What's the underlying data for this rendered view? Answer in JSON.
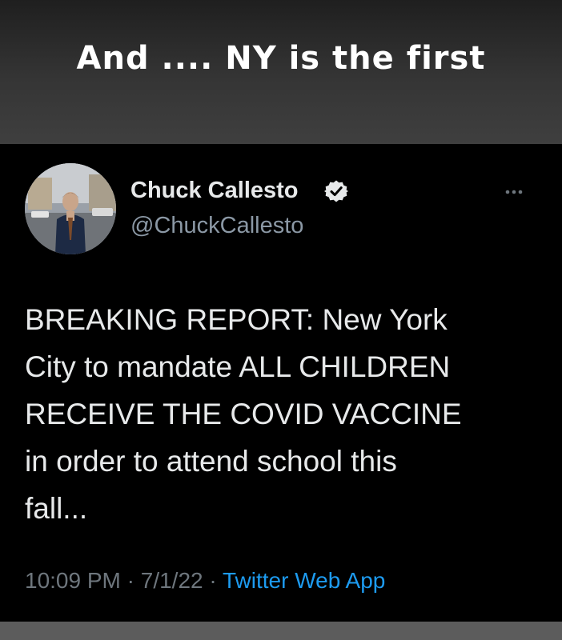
{
  "caption": {
    "text": "And .... NY is the first"
  },
  "tweet": {
    "author": {
      "name": "Chuck Callesto",
      "handle": "@ChuckCallesto",
      "verified": true,
      "avatar_icon": "profile-photo-icon"
    },
    "more_icon": "more-options-icon",
    "body_lines": [
      "BREAKING REPORT: New York",
      "City to mandate ALL CHILDREN",
      "RECEIVE THE COVID VACCINE",
      "in order to attend school this",
      "fall..."
    ],
    "meta": {
      "time": "10:09 PM",
      "separator": " · ",
      "date": "7/1/22",
      "source": "Twitter Web App"
    }
  },
  "colors": {
    "background": "#000000",
    "text_primary": "#e7e9ea",
    "text_secondary": "#8b98a5",
    "link": "#1d9bf0"
  }
}
